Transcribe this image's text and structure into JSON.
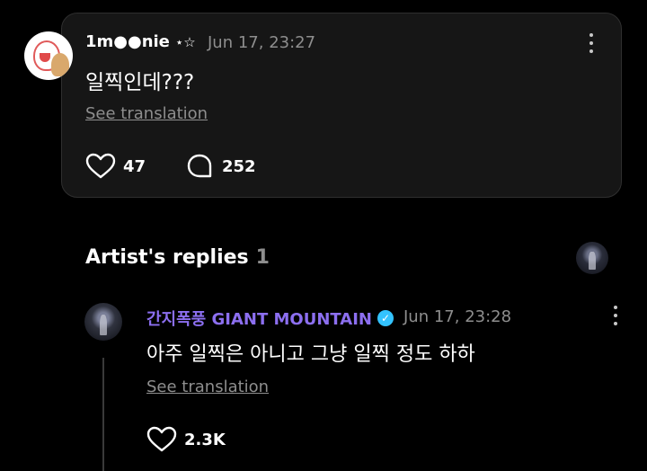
{
  "post": {
    "author": "1m●●nie",
    "author_decoration": "⋆☆",
    "timestamp": "Jun 17, 23:27",
    "text": "일찍인데???",
    "translate_label": "See translation",
    "likes": "47",
    "comments": "252"
  },
  "artist_replies": {
    "title": "Artist's replies",
    "count": "1"
  },
  "reply": {
    "author": "간지폭풍 GIANT MOUNTAIN",
    "verified_icon": "verified-badge-icon",
    "timestamp": "Jun 17, 23:28",
    "text": "아주 일찍은 아니고 그냥 일찍 정도 하하",
    "translate_label": "See translation",
    "likes": "2.3K"
  },
  "colors": {
    "background": "#000000",
    "card": "#161616",
    "artist_name": "#8c6ff0",
    "verified": "#33c3ff",
    "muted_text": "#8e8e8e"
  }
}
